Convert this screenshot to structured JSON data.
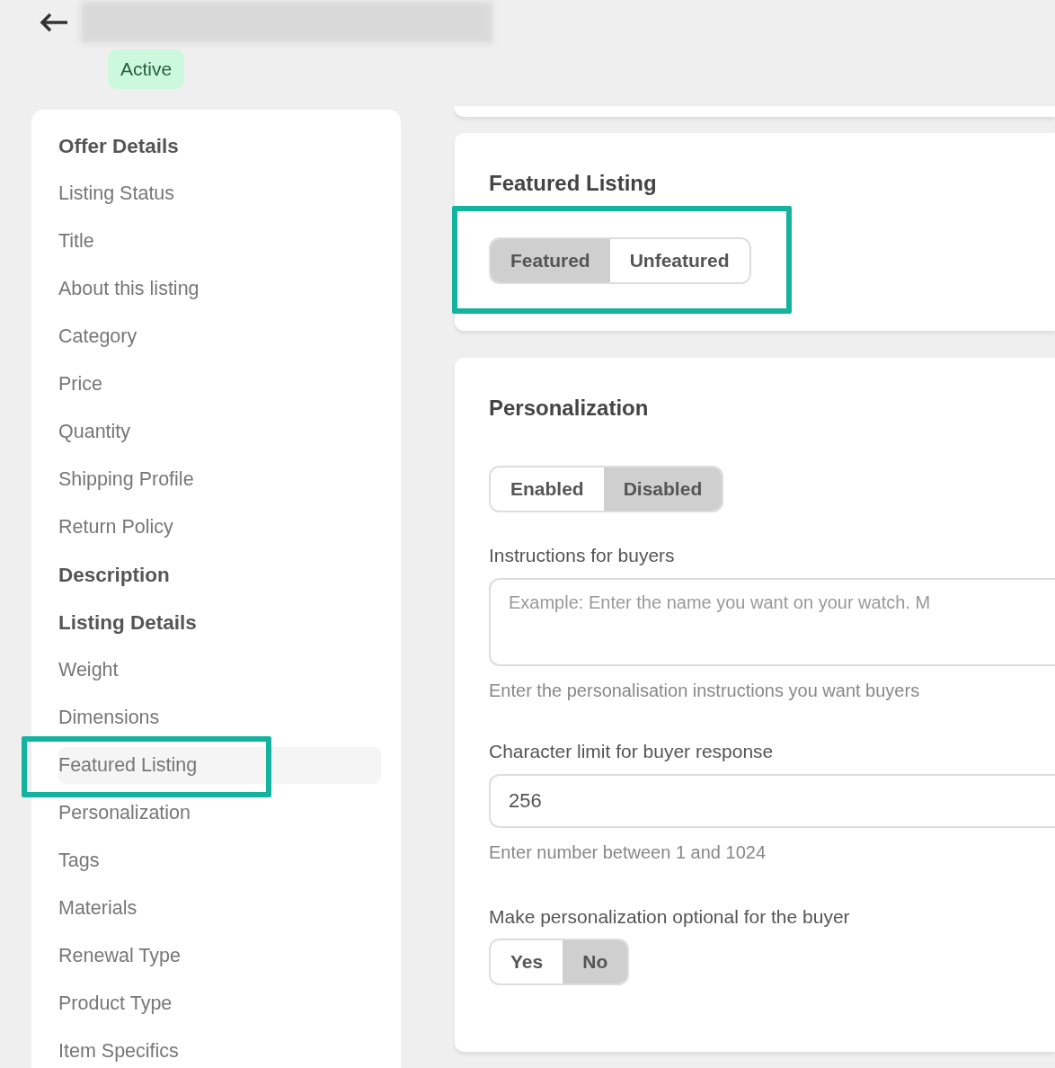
{
  "header": {
    "status": "Active"
  },
  "sidebar": {
    "items": [
      {
        "label": "Offer Details",
        "kind": "heading",
        "selected": false,
        "highlighted": false
      },
      {
        "label": "Listing Status",
        "kind": "item",
        "selected": false,
        "highlighted": false
      },
      {
        "label": "Title",
        "kind": "item",
        "selected": false,
        "highlighted": false
      },
      {
        "label": "About this listing",
        "kind": "item",
        "selected": false,
        "highlighted": false
      },
      {
        "label": "Category",
        "kind": "item",
        "selected": false,
        "highlighted": false
      },
      {
        "label": "Price",
        "kind": "item",
        "selected": false,
        "highlighted": false
      },
      {
        "label": "Quantity",
        "kind": "item",
        "selected": false,
        "highlighted": false
      },
      {
        "label": "Shipping Profile",
        "kind": "item",
        "selected": false,
        "highlighted": false
      },
      {
        "label": "Return Policy",
        "kind": "item",
        "selected": false,
        "highlighted": false
      },
      {
        "label": "Description",
        "kind": "heading",
        "selected": false,
        "highlighted": false
      },
      {
        "label": "Listing Details",
        "kind": "heading",
        "selected": false,
        "highlighted": false
      },
      {
        "label": "Weight",
        "kind": "item",
        "selected": false,
        "highlighted": false
      },
      {
        "label": "Dimensions",
        "kind": "item",
        "selected": false,
        "highlighted": false
      },
      {
        "label": "Featured Listing",
        "kind": "item",
        "selected": true,
        "highlighted": true
      },
      {
        "label": "Personalization",
        "kind": "item",
        "selected": false,
        "highlighted": false
      },
      {
        "label": "Tags",
        "kind": "item",
        "selected": false,
        "highlighted": false
      },
      {
        "label": "Materials",
        "kind": "item",
        "selected": false,
        "highlighted": false
      },
      {
        "label": "Renewal Type",
        "kind": "item",
        "selected": false,
        "highlighted": false
      },
      {
        "label": "Product Type",
        "kind": "item",
        "selected": false,
        "highlighted": false
      },
      {
        "label": "Item Specifics",
        "kind": "item",
        "selected": false,
        "highlighted": false
      }
    ]
  },
  "featured": {
    "title": "Featured Listing",
    "highlighted": true,
    "options": [
      {
        "label": "Featured",
        "selected": true
      },
      {
        "label": "Unfeatured",
        "selected": false
      }
    ]
  },
  "personalization": {
    "title": "Personalization",
    "options": [
      {
        "label": "Enabled",
        "selected": false
      },
      {
        "label": "Disabled",
        "selected": true
      }
    ],
    "instructions": {
      "label": "Instructions for buyers",
      "placeholder": "Example: Enter the name you want on your watch. M",
      "help": "Enter the personalisation instructions you want buyers"
    },
    "char_limit": {
      "label": "Character limit for buyer response",
      "value": "256",
      "help": "Enter number between 1 and 1024"
    },
    "optional": {
      "label": "Make personalization optional for the buyer",
      "options": [
        {
          "label": "Yes",
          "selected": false
        },
        {
          "label": "No",
          "selected": true
        }
      ]
    }
  }
}
